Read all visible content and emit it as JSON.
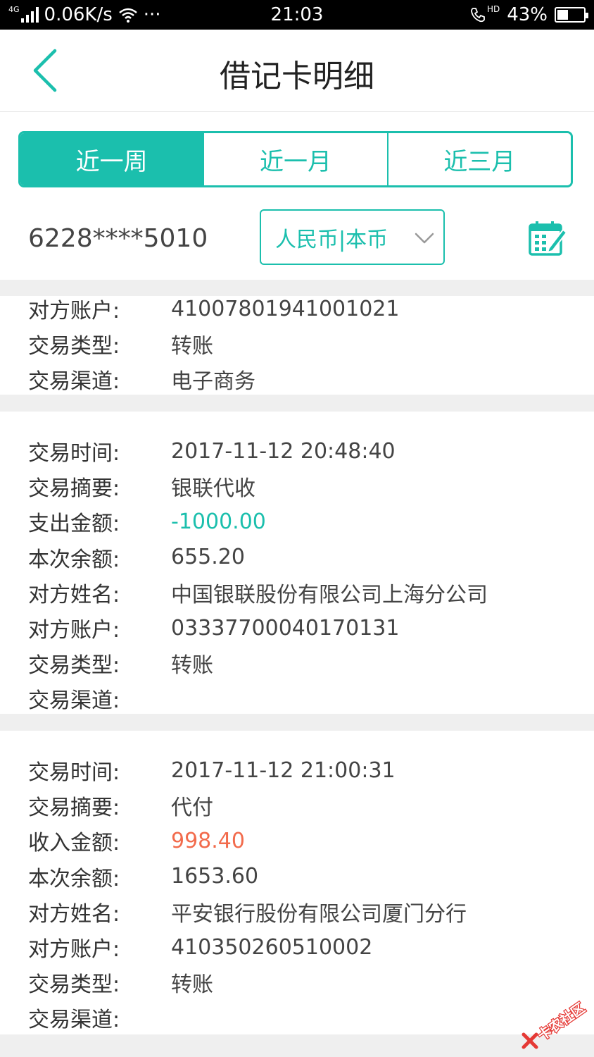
{
  "status_bar": {
    "network_type": "4G",
    "speed": "0.06K/s",
    "more": "···",
    "time": "21:03",
    "hd": "HD",
    "battery_percent": "43%",
    "battery_level": 0.43
  },
  "header": {
    "title": "借记卡明细"
  },
  "tabs": [
    {
      "label": "近一周",
      "active": true
    },
    {
      "label": "近一月",
      "active": false
    },
    {
      "label": "近三月",
      "active": false
    }
  ],
  "filter": {
    "card_number": "6228****5010",
    "currency": "人民币|本币"
  },
  "records": [
    {
      "rows": [
        {
          "key": "对方账户:",
          "value": "41007801941001021"
        },
        {
          "key": "交易类型:",
          "value": "转账"
        },
        {
          "key": "交易渠道:",
          "value": "电子商务"
        }
      ]
    },
    {
      "rows": [
        {
          "key": "交易时间:",
          "value": "2017-11-12 20:48:40"
        },
        {
          "key": "交易摘要:",
          "value": "银联代收"
        },
        {
          "key": "支出金额:",
          "value": "-1000.00",
          "kind": "expense"
        },
        {
          "key": "本次余额:",
          "value": "655.20"
        },
        {
          "key": "对方姓名:",
          "value": "中国银联股份有限公司上海分公司"
        },
        {
          "key": "对方账户:",
          "value": "03337700040170131"
        },
        {
          "key": "交易类型:",
          "value": "转账"
        },
        {
          "key": "交易渠道:",
          "value": ""
        }
      ]
    },
    {
      "rows": [
        {
          "key": "交易时间:",
          "value": "2017-11-12 21:00:31"
        },
        {
          "key": "交易摘要:",
          "value": "代付"
        },
        {
          "key": "收入金额:",
          "value": "998.40",
          "kind": "income"
        },
        {
          "key": "本次余额:",
          "value": "1653.60"
        },
        {
          "key": "对方姓名:",
          "value": "平安银行股份有限公司厦门分行"
        },
        {
          "key": "对方账户:",
          "value": "410350260510002"
        },
        {
          "key": "交易类型:",
          "value": "转账"
        },
        {
          "key": "交易渠道:",
          "value": ""
        }
      ]
    }
  ],
  "watermark": {
    "text": "卡农社区"
  },
  "colors": {
    "accent": "#1bbfad",
    "income": "#f26b4c",
    "separator": "#efefef"
  }
}
